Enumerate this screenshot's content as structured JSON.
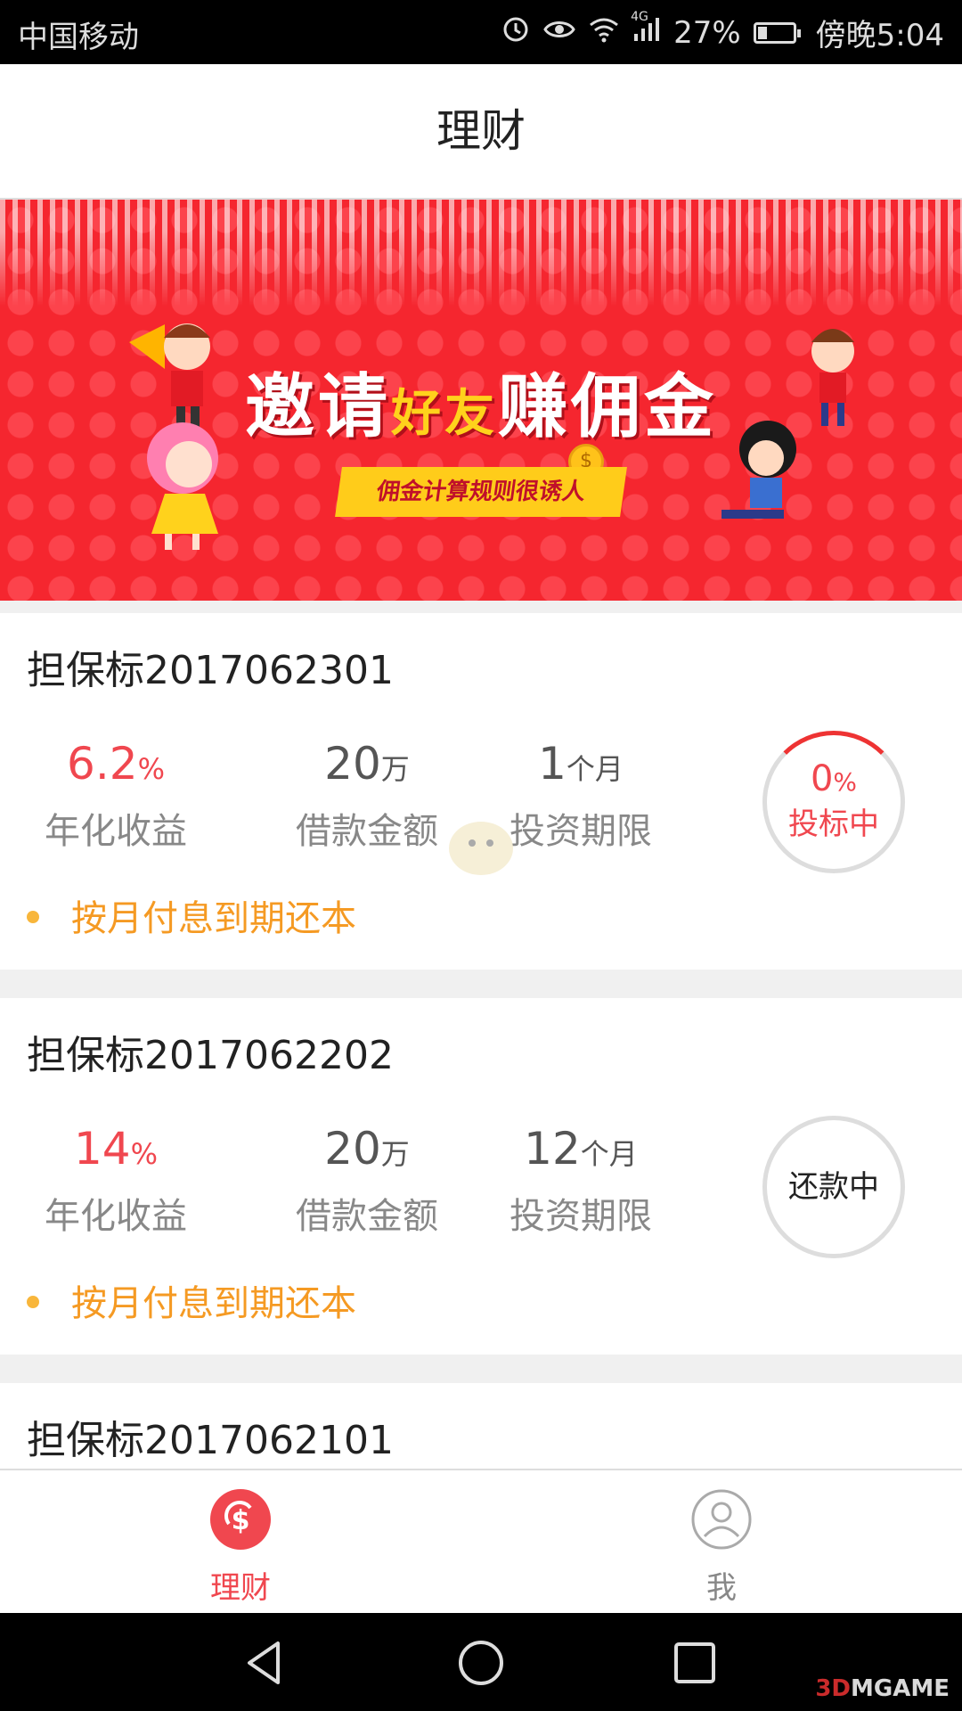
{
  "status_bar": {
    "carrier": "中国移动",
    "network": "4G",
    "battery": "27%",
    "time": "傍晚5:04"
  },
  "header": {
    "title": "理财"
  },
  "banner": {
    "headline_pre": "邀请",
    "headline_mid": "好友",
    "headline_post": "赚佣金",
    "ribbon": "佣金计算规则很诱人",
    "coin": "$"
  },
  "loans": [
    {
      "name": "担保标2017062301",
      "rate_value": "6.2",
      "rate_unit": "%",
      "rate_label": "年化收益",
      "amount_value": "20",
      "amount_unit": "万",
      "amount_label": "借款金额",
      "term_value": "1",
      "term_unit": "个月",
      "term_label": "投资期限",
      "repayment": "按月付息到期还本",
      "progress_value": "0",
      "progress_unit": "%",
      "status": "投标中"
    },
    {
      "name": "担保标2017062202",
      "rate_value": "14",
      "rate_unit": "%",
      "rate_label": "年化收益",
      "amount_value": "20",
      "amount_unit": "万",
      "amount_label": "借款金额",
      "term_value": "12",
      "term_unit": "个月",
      "term_label": "投资期限",
      "repayment": "按月付息到期还本",
      "status": "还款中"
    },
    {
      "name": "担保标2017062101"
    }
  ],
  "tab_bar": {
    "tabs": [
      {
        "label": "理财",
        "icon": "finance-dollar-icon",
        "active": true
      },
      {
        "label": "我",
        "icon": "user-profile-icon",
        "active": false
      }
    ]
  },
  "watermark": {
    "prefix": "3D",
    "suffix": "MGAME"
  },
  "colors": {
    "accent": "#f0474f",
    "orange": "#f59a23",
    "banner_red": "#f5262f"
  }
}
